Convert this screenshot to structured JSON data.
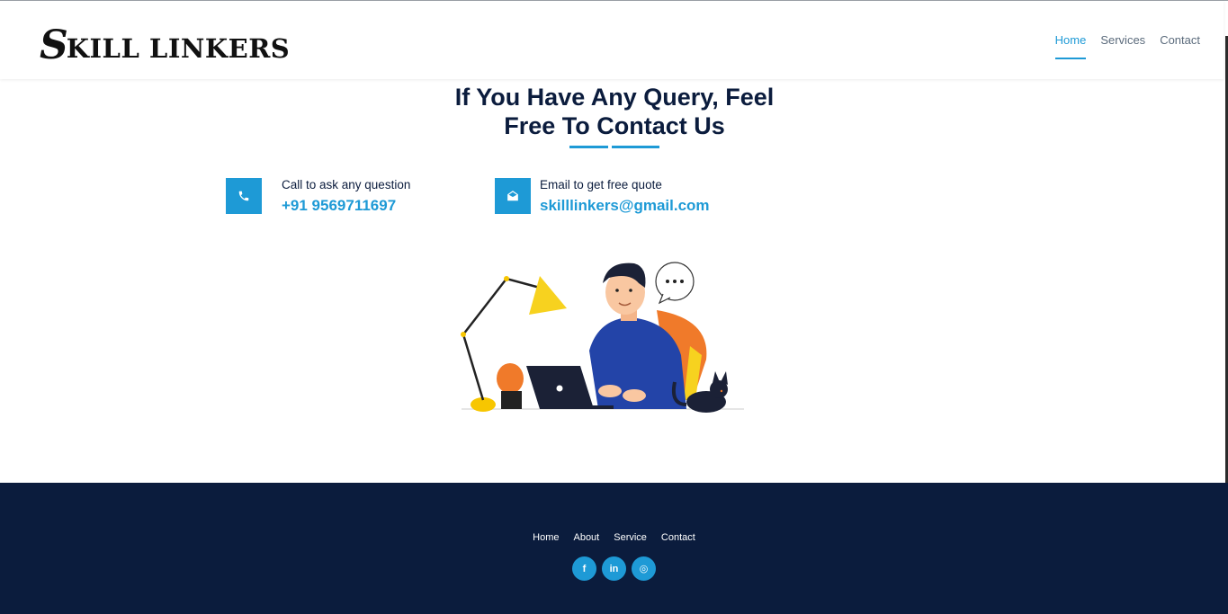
{
  "header": {
    "logo_initial": "S",
    "logo_text": "KILL LINKERS",
    "nav": [
      {
        "label": "Home",
        "active": true
      },
      {
        "label": "Services",
        "active": false
      },
      {
        "label": "Contact",
        "active": false
      }
    ]
  },
  "main": {
    "title_line1": "If You Have Any Query, Feel",
    "title_line2": "Free To Contact Us",
    "phone": {
      "label": "Call to ask any question",
      "value": "+91 9569711697",
      "icon": "phone-icon"
    },
    "email": {
      "label": "Email to get free quote",
      "value": "skilllinkers@gmail.com",
      "icon": "envelope-icon"
    }
  },
  "footer": {
    "links": [
      "Home",
      "About",
      "Service",
      "Contact"
    ],
    "socials": [
      {
        "icon": "facebook-icon",
        "glyph": "f"
      },
      {
        "icon": "linkedin-icon",
        "glyph": "in"
      },
      {
        "icon": "instagram-icon",
        "glyph": "◎"
      }
    ]
  },
  "colors": {
    "accent": "#1e9ad6",
    "navy": "#0b1c3d"
  }
}
